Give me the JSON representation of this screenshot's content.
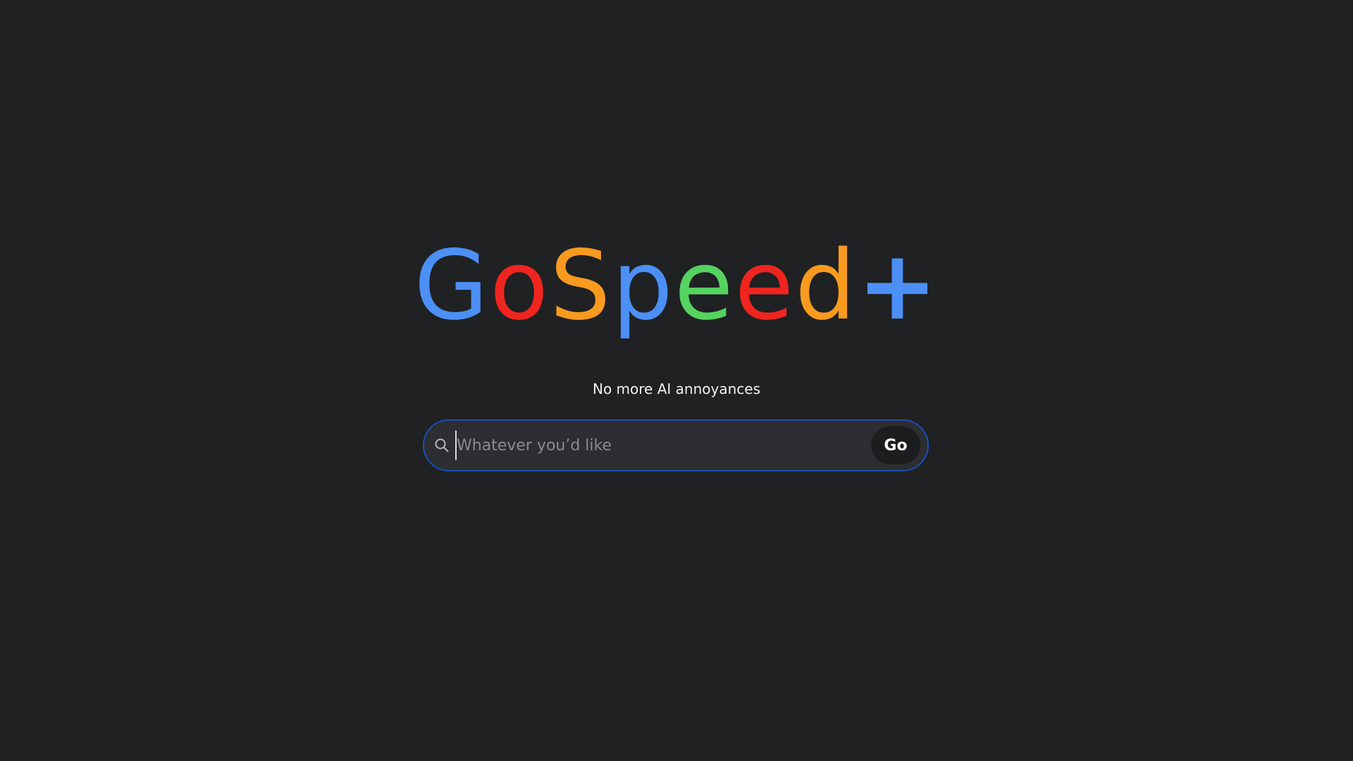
{
  "logo": {
    "letters": [
      {
        "char": "G",
        "color": "#4c8ff5"
      },
      {
        "char": "o",
        "color": "#f0251f"
      },
      {
        "char": "S",
        "color": "#fa9a1f"
      },
      {
        "char": "p",
        "color": "#4c8ff5"
      },
      {
        "char": "e",
        "color": "#55d35f"
      },
      {
        "char": "e",
        "color": "#f0251f"
      },
      {
        "char": "d",
        "color": "#fa9a1f"
      },
      {
        "char": "+",
        "color": "#4c8ff5"
      }
    ]
  },
  "tagline": "No more AI annoyances",
  "search": {
    "icon": "search-icon",
    "placeholder": "Whatever you’d like",
    "value": "",
    "border_color": "#1a4fb5"
  },
  "go_button": {
    "label": "Go"
  }
}
